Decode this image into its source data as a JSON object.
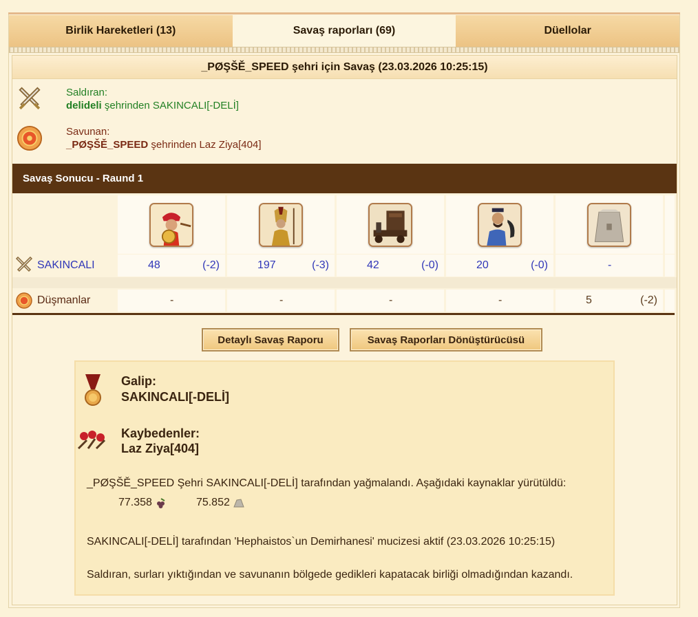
{
  "tabs": [
    {
      "label": "Birlik Hareketleri (13)"
    },
    {
      "label": "Savaş raporları (69)"
    },
    {
      "label": "Düellolar"
    }
  ],
  "report": {
    "title": "_PØŞŠĚ_SPEED şehri için Savaş (23.03.2026 10:25:15)",
    "attacker": {
      "label": "Saldıran:",
      "city": "delideli",
      "suffix": " şehrinden SAKINCALI[-DELİ]"
    },
    "defender": {
      "label": "Savunan:",
      "city": "_PØŞŠĚ_SPEED",
      "suffix": " şehrinden Laz Ziya[404]"
    },
    "result_title": "Savaş Sonucu - Raund 1",
    "attacker_row": {
      "name": "SAKINCALI",
      "units": [
        {
          "count": "48",
          "loss": "(-2)"
        },
        {
          "count": "197",
          "loss": "(-3)"
        },
        {
          "count": "42",
          "loss": "(-0)"
        },
        {
          "count": "20",
          "loss": "(-0)"
        },
        {
          "count": "-",
          "loss": ""
        }
      ]
    },
    "enemy_row": {
      "name": "Düşmanlar",
      "units": [
        {
          "count": "-",
          "loss": ""
        },
        {
          "count": "-",
          "loss": ""
        },
        {
          "count": "-",
          "loss": ""
        },
        {
          "count": "-",
          "loss": ""
        },
        {
          "count": "5",
          "loss": "(-2)"
        }
      ]
    },
    "unit_icons": [
      "hoplite-unit-icon",
      "spartan-unit-icon",
      "battering-ram-icon",
      "archer-unit-icon",
      "wall-icon"
    ],
    "buttons": {
      "detailed": "Detaylı Savaş Raporu",
      "converter": "Savaş Raporları Dönüştürücüsü"
    },
    "summary": {
      "winner_label": "Galip:",
      "winner": "SAKINCALI[-DELİ]",
      "losers_label": "Kaybedenler:",
      "loser": "Laz Ziya[404]",
      "plunder_text": "_PØŞŠĚ_SPEED Şehri SAKINCALI[-DELİ] tarafından yağmalandı. Aşağıdaki kaynaklar yürütüldü:",
      "wine": "77.358",
      "marble": "75.852",
      "wonder_text": "SAKINCALI[-DELİ] tarafından 'Hephaistos`un Demirhanesi' mucizesi aktif (23.03.2026 10:25:15)",
      "reason_text": "Saldıran, surları yıktığından ve savunanın bölgede gedikleri kapatacak birliği olmadığından kazandı."
    }
  }
}
